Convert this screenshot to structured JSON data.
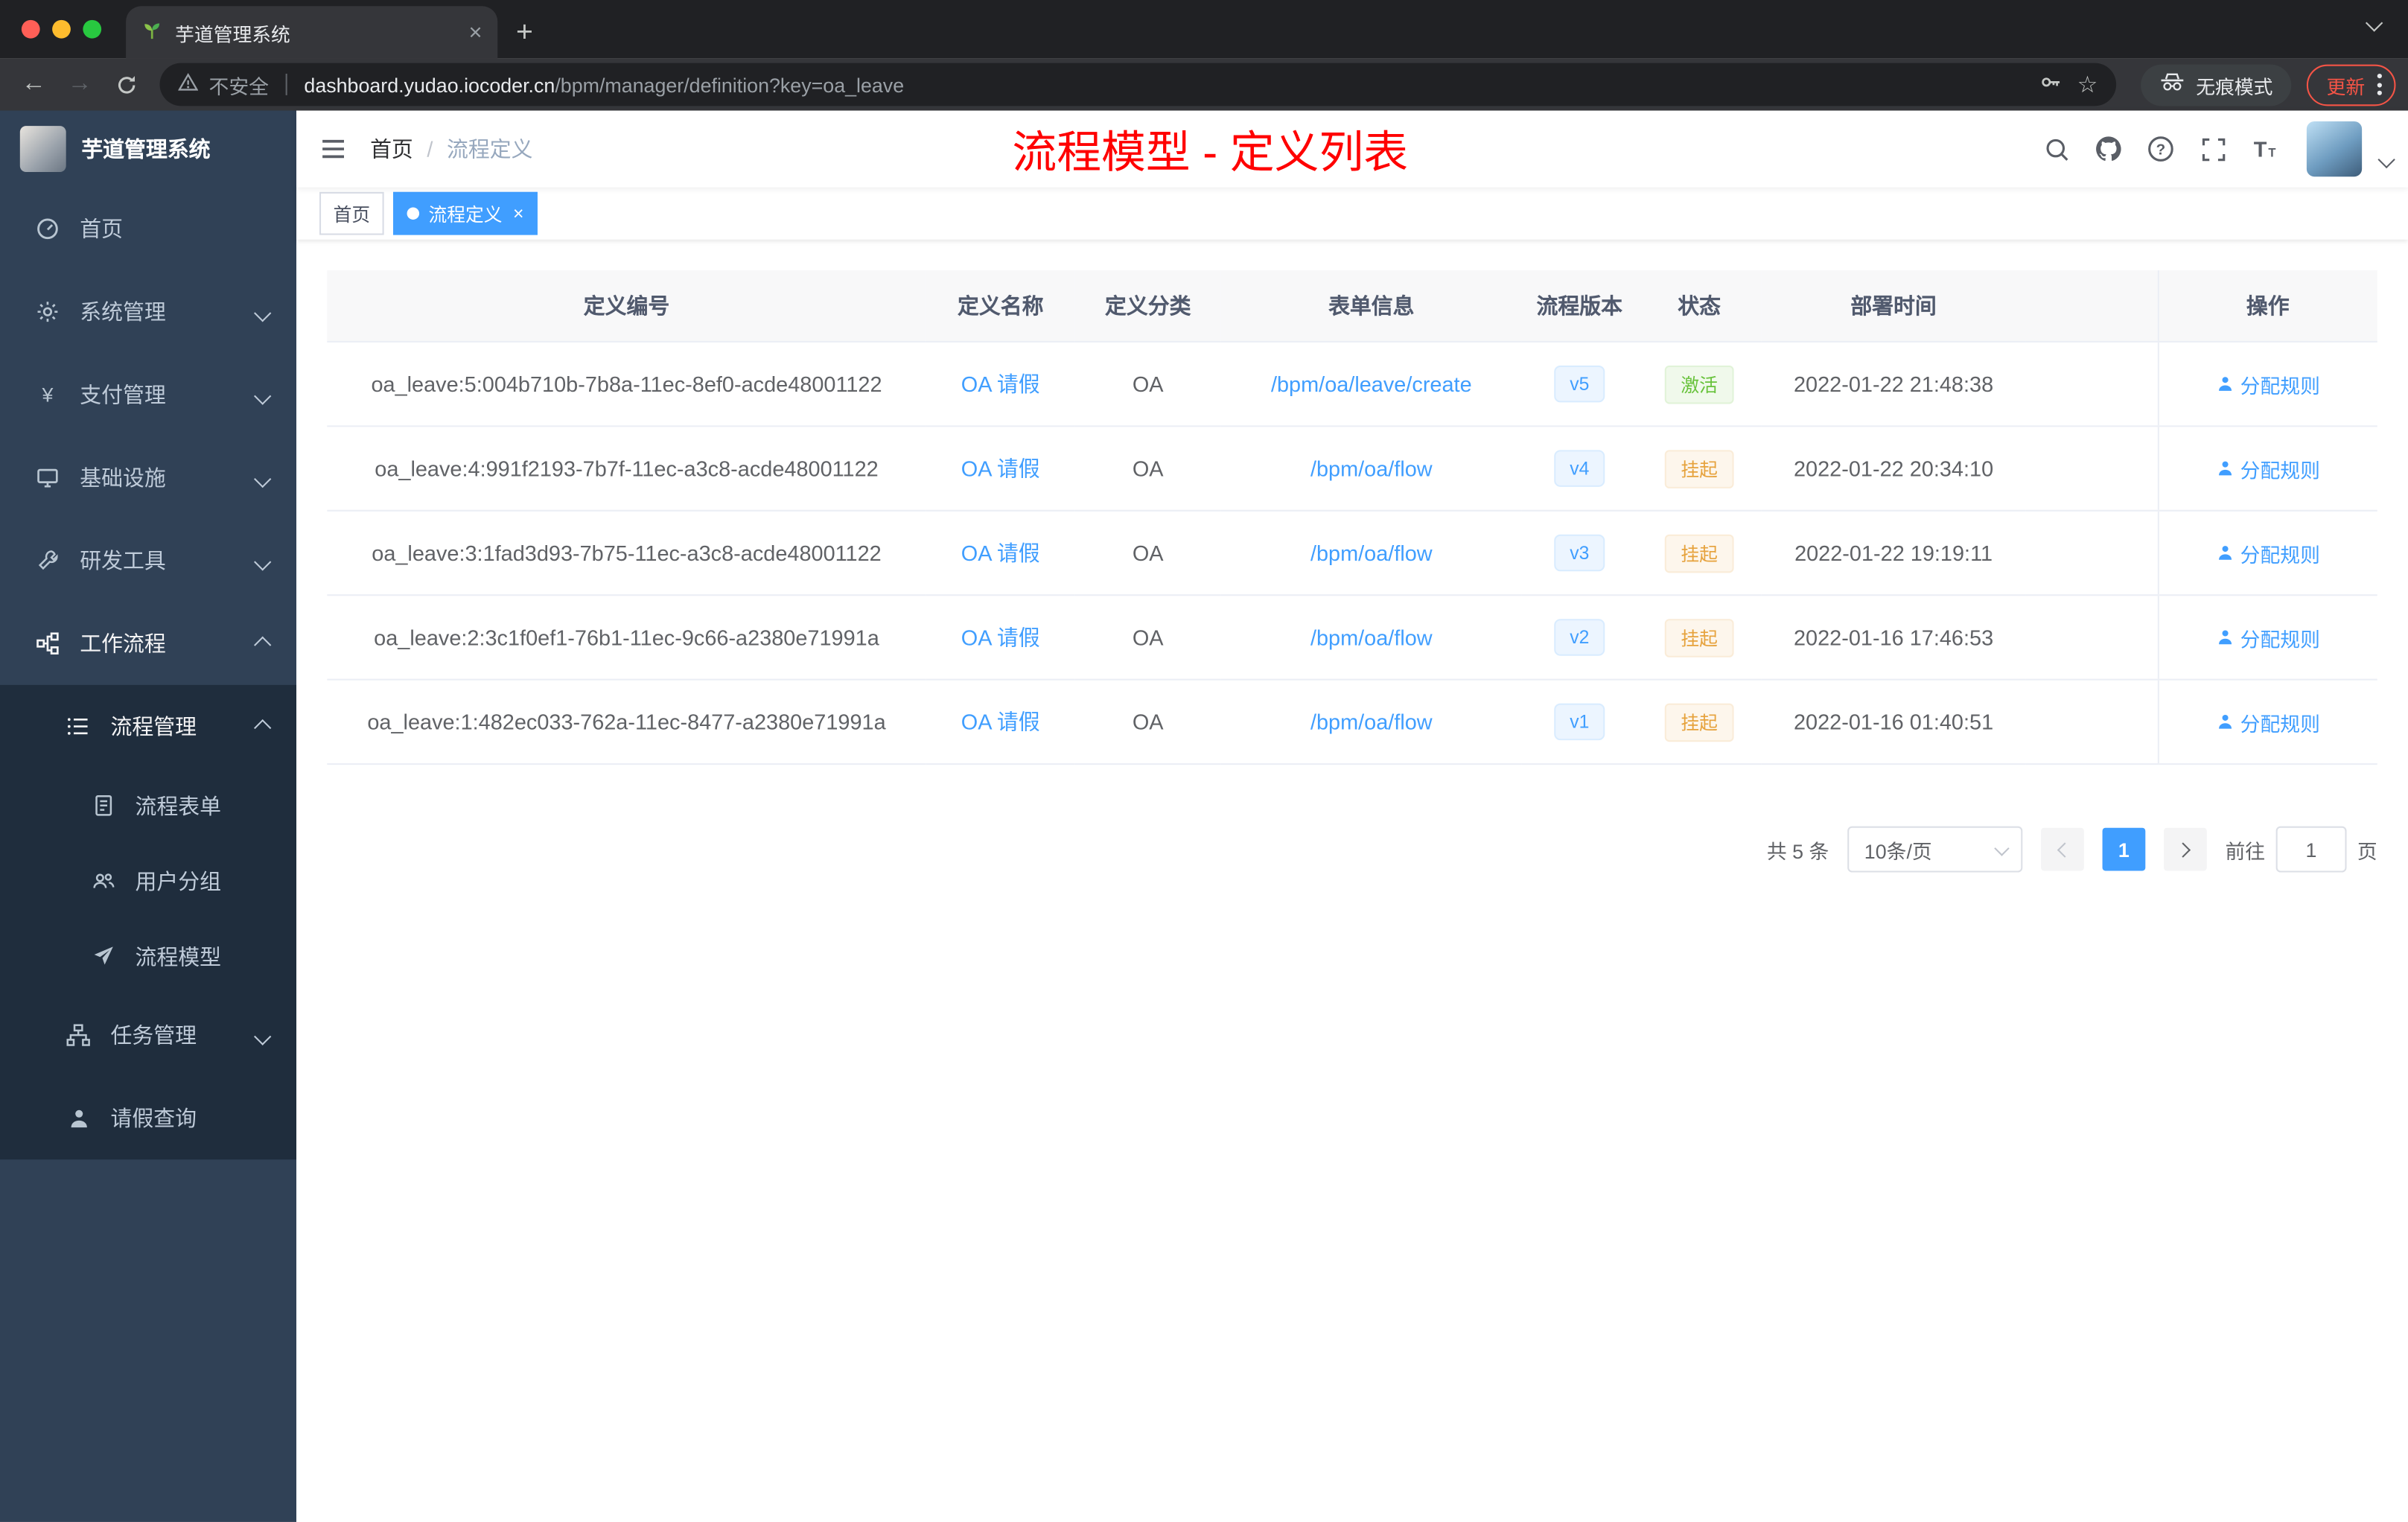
{
  "browser": {
    "tab_title": "芋道管理系统",
    "new_tab": "+",
    "security_label": "不安全",
    "url_host": "dashboard.yudao.iocoder.cn",
    "url_path": "/bpm/manager/definition?key=oa_leave",
    "incognito_label": "无痕模式",
    "update_label": "更新"
  },
  "sidebar": {
    "logo_title": "芋道管理系统",
    "menu": [
      {
        "label": "首页"
      },
      {
        "label": "系统管理"
      },
      {
        "label": "支付管理"
      },
      {
        "label": "基础设施"
      },
      {
        "label": "研发工具"
      },
      {
        "label": "工作流程"
      },
      {
        "label": "流程管理"
      },
      {
        "label": "流程表单"
      },
      {
        "label": "用户分组"
      },
      {
        "label": "流程模型"
      },
      {
        "label": "任务管理"
      },
      {
        "label": "请假查询"
      }
    ]
  },
  "header": {
    "breadcrumb": {
      "home": "首页",
      "separator": "/",
      "current": "流程定义"
    },
    "annotation_title": "流程模型 - 定义列表"
  },
  "tags": {
    "first": "首页",
    "active": "流程定义",
    "close": "×"
  },
  "table": {
    "columns": [
      "定义编号",
      "定义名称",
      "定义分类",
      "表单信息",
      "流程版本",
      "状态",
      "部署时间",
      "操作"
    ],
    "rows": [
      {
        "id": "oa_leave:5:004b710b-7b8a-11ec-8ef0-acde48001122",
        "name": "OA 请假",
        "category": "OA",
        "form": "/bpm/oa/leave/create",
        "version": "v5",
        "status": "激活",
        "time": "2022-01-22 21:48:38",
        "action": "分配规则"
      },
      {
        "id": "oa_leave:4:991f2193-7b7f-11ec-a3c8-acde48001122",
        "name": "OA 请假",
        "category": "OA",
        "form": "/bpm/oa/flow",
        "version": "v4",
        "status": "挂起",
        "time": "2022-01-22 20:34:10",
        "action": "分配规则"
      },
      {
        "id": "oa_leave:3:1fad3d93-7b75-11ec-a3c8-acde48001122",
        "name": "OA 请假",
        "category": "OA",
        "form": "/bpm/oa/flow",
        "version": "v3",
        "status": "挂起",
        "time": "2022-01-22 19:19:11",
        "action": "分配规则"
      },
      {
        "id": "oa_leave:2:3c1f0ef1-76b1-11ec-9c66-a2380e71991a",
        "name": "OA 请假",
        "category": "OA",
        "form": "/bpm/oa/flow",
        "version": "v2",
        "status": "挂起",
        "time": "2022-01-16 17:46:53",
        "action": "分配规则"
      },
      {
        "id": "oa_leave:1:482ec033-762a-11ec-8477-a2380e71991a",
        "name": "OA 请假",
        "category": "OA",
        "form": "/bpm/oa/flow",
        "version": "v1",
        "status": "挂起",
        "time": "2022-01-16 01:40:51",
        "action": "分配规则"
      }
    ]
  },
  "pagination": {
    "total": "共 5 条",
    "page_size": "10条/页",
    "page": "1",
    "goto": "前往",
    "goto_value": "1",
    "page_unit": "页"
  },
  "colors": {
    "primary": "#409eff",
    "success": "#67c23a",
    "warning": "#e6a23c",
    "annotation_red": "#ff0000",
    "sidebar_bg": "#304156",
    "submenu_bg": "#1f2d3d"
  }
}
